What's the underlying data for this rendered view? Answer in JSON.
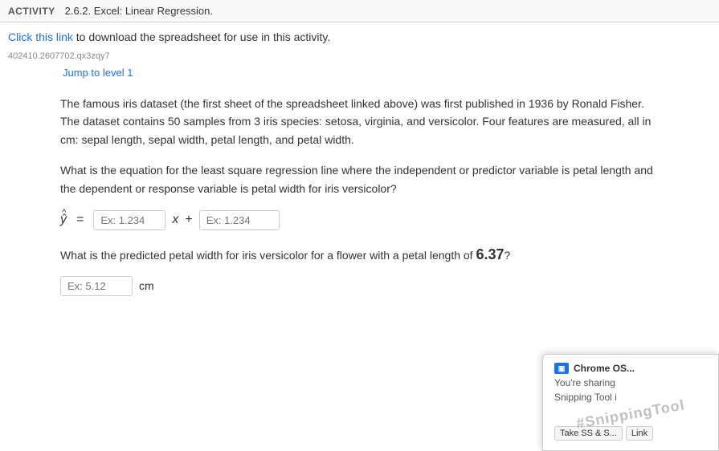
{
  "topbar": {
    "activity_label": "ACTIVITY",
    "activity_title": "2.6.2. Excel: Linear Regression."
  },
  "content": {
    "click_link_text": "Click this link",
    "click_link_rest": " to download the spreadsheet for use in this activity.",
    "file_id": "402410.2607702.qx3zqy7",
    "jump_link": "Jump to level 1",
    "paragraph1": "The famous iris dataset (the first sheet of the spreadsheet linked above) was first published in 1936 by Ronald Fisher. The dataset contains 50 samples from 3 iris species: setosa, virginia, and versicolor. Four features are measured, all in cm: sepal length, sepal width, petal length, and petal width.",
    "paragraph2_q1": "What is the equation for the least square regression line where the independent or predictor variable is petal length and the dependent or response variable is petal width for iris versicolor?",
    "y_hat_label": "ŷ",
    "equals_label": "=",
    "coeff_placeholder": "Ex: 1.234",
    "x_label": "x",
    "plus_label": "+",
    "intercept_placeholder": "Ex: 1.234",
    "question2_pre": "What is the predicted petal width for iris versicolor for a flower with a petal length of ",
    "question2_value": "6.37",
    "question2_post": "?",
    "answer_placeholder": "Ex: 5.12",
    "cm_label": "cm"
  },
  "snipping": {
    "header": "Chrome OS...",
    "line1": "You're sharing",
    "line2": "Snipping Tool i",
    "watermark": "#SnippingTool",
    "btn1": "Take SS & S...",
    "btn2": "Link"
  }
}
